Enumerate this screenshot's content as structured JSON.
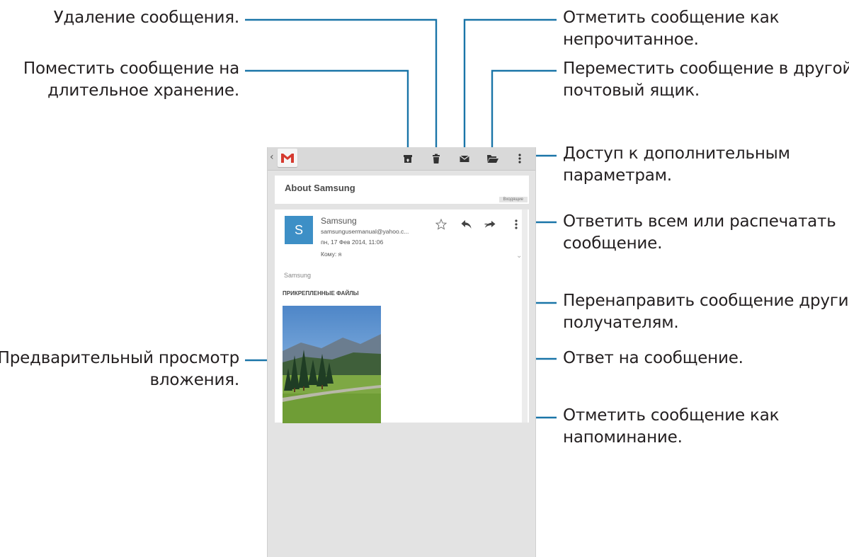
{
  "callouts": {
    "delete": "Удаление сообщения.",
    "archive_line1": "Поместить сообщение на",
    "archive_line2": "длительное хранение.",
    "mark_unread_line1": "Отметить сообщение как",
    "mark_unread_line2": "непрочитанное.",
    "move_line1": "Переместить сообщение в другой",
    "move_line2": "почтовый ящик.",
    "more_options_line1": "Доступ к дополнительным",
    "more_options_line2": "параметрам.",
    "reply_all_line1": "Ответить всем или распечатать",
    "reply_all_line2": "сообщение.",
    "forward_line1": "Перенаправить сообщение другим",
    "forward_line2": "получателям.",
    "reply": "Ответ на сообщение.",
    "star_line1": "Отметить сообщение как",
    "star_line2": "напоминание.",
    "preview_line1": "Предварительный просмотр",
    "preview_line2": "вложения."
  },
  "screen": {
    "actionbar": {
      "back_icon": "chevron-left-icon",
      "app_icon": "gmail-icon",
      "actions": [
        "archive-icon",
        "delete-icon",
        "mark-unread-icon",
        "move-folder-icon",
        "overflow-menu-icon"
      ]
    },
    "subject": "About Samsung",
    "label": "Входящие",
    "message": {
      "avatar_letter": "S",
      "sender": "Samsung",
      "email": "samsungusermanual@yahoo.c...",
      "date": "пн, 17 Фев 2014, 11:06",
      "to": "Кому: я",
      "body": "Samsung",
      "attachments_heading": "ПРИКРЕПЛЕННЫЕ ФАЙЛЫ"
    }
  },
  "colors": {
    "leader": "#1a75a8",
    "accent": "#3d8fc6",
    "gmail_red": "#d53a2f"
  }
}
